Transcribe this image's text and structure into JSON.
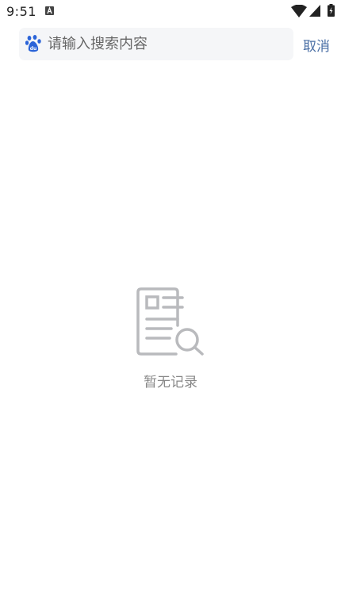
{
  "status_bar": {
    "time": "9:51",
    "icons": [
      "a-icon",
      "wifi-icon",
      "signal-icon",
      "battery-icon"
    ]
  },
  "search": {
    "logo_icon": "baidu-paw-icon",
    "placeholder": "请输入搜索内容",
    "value": "",
    "cancel_label": "取消"
  },
  "empty_state": {
    "icon": "document-search-icon",
    "message": "暂无记录"
  },
  "colors": {
    "accent": "#4a6fa5",
    "baidu_blue": "#2b64d8",
    "search_bg": "#f5f6f8",
    "empty_icon": "#b9babd",
    "empty_text": "#888888"
  }
}
